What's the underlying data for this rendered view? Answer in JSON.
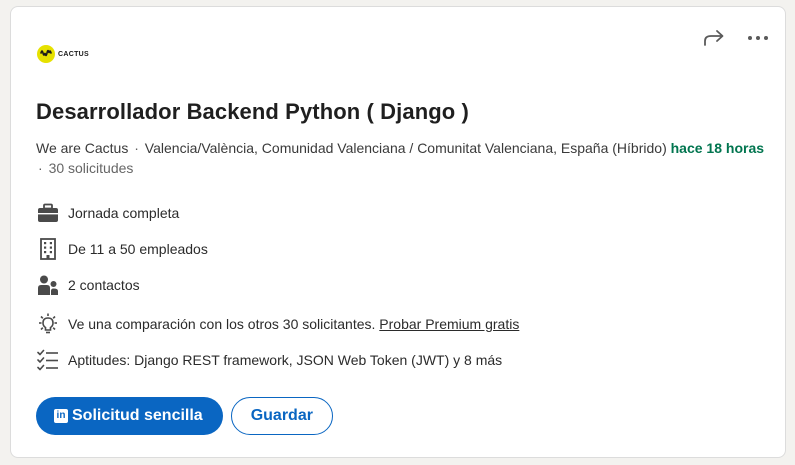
{
  "company_logo": {
    "text": "CACTUS",
    "accent": "#e6e100"
  },
  "actions": {
    "share_icon": "share-arrow-icon",
    "more_icon": "more-horizontal-icon"
  },
  "job": {
    "title": "Desarrollador Backend Python ( Django )",
    "company": "We are Cactus",
    "location": "Valencia/València, Comunidad Valenciana / Comunitat Valenciana, España (Híbrido)",
    "posted": "hace 18 horas",
    "applicants": "30 solicitudes",
    "separator": "·"
  },
  "features": {
    "employment_type": "Jornada completa",
    "company_size": "De 11 a 50 empleados",
    "contacts": "2 contactos",
    "comparison_text": "Ve una comparación con los otros 30 solicitantes.",
    "premium_link": "Probar Premium gratis",
    "skills": "Aptitudes: Django REST framework, JSON Web Token (JWT) y 8 más"
  },
  "buttons": {
    "apply_badge": "in",
    "apply": "Solicitud sencilla",
    "save": "Guardar"
  },
  "colors": {
    "primary": "#0a66c2",
    "posted_green": "#01754f"
  }
}
